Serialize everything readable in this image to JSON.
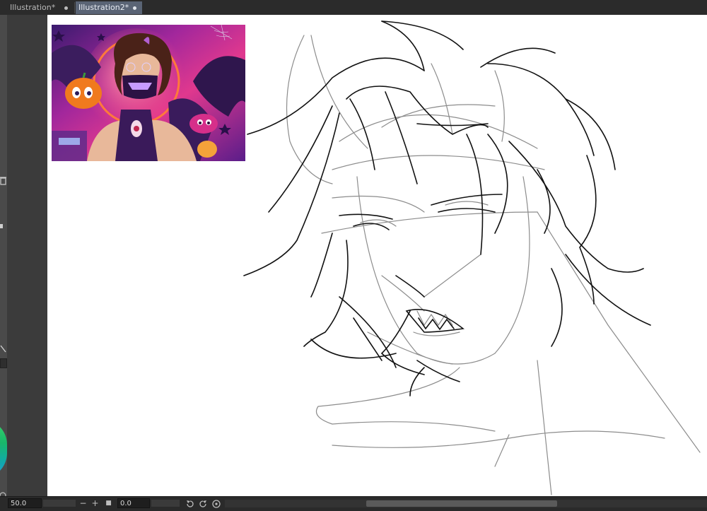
{
  "tabs": [
    {
      "label": "Illustration*",
      "active": false
    },
    {
      "label": "Illustration2*",
      "active": true
    }
  ],
  "statusbar": {
    "zoom": "50.0",
    "angle": "0.0",
    "minus": "−",
    "plus": "+",
    "fit": "■",
    "scroll_arrow": "◂"
  },
  "colors": {
    "accent": "#5a6475",
    "canvas": "#ffffff",
    "chrome": "#2b2b2b"
  }
}
